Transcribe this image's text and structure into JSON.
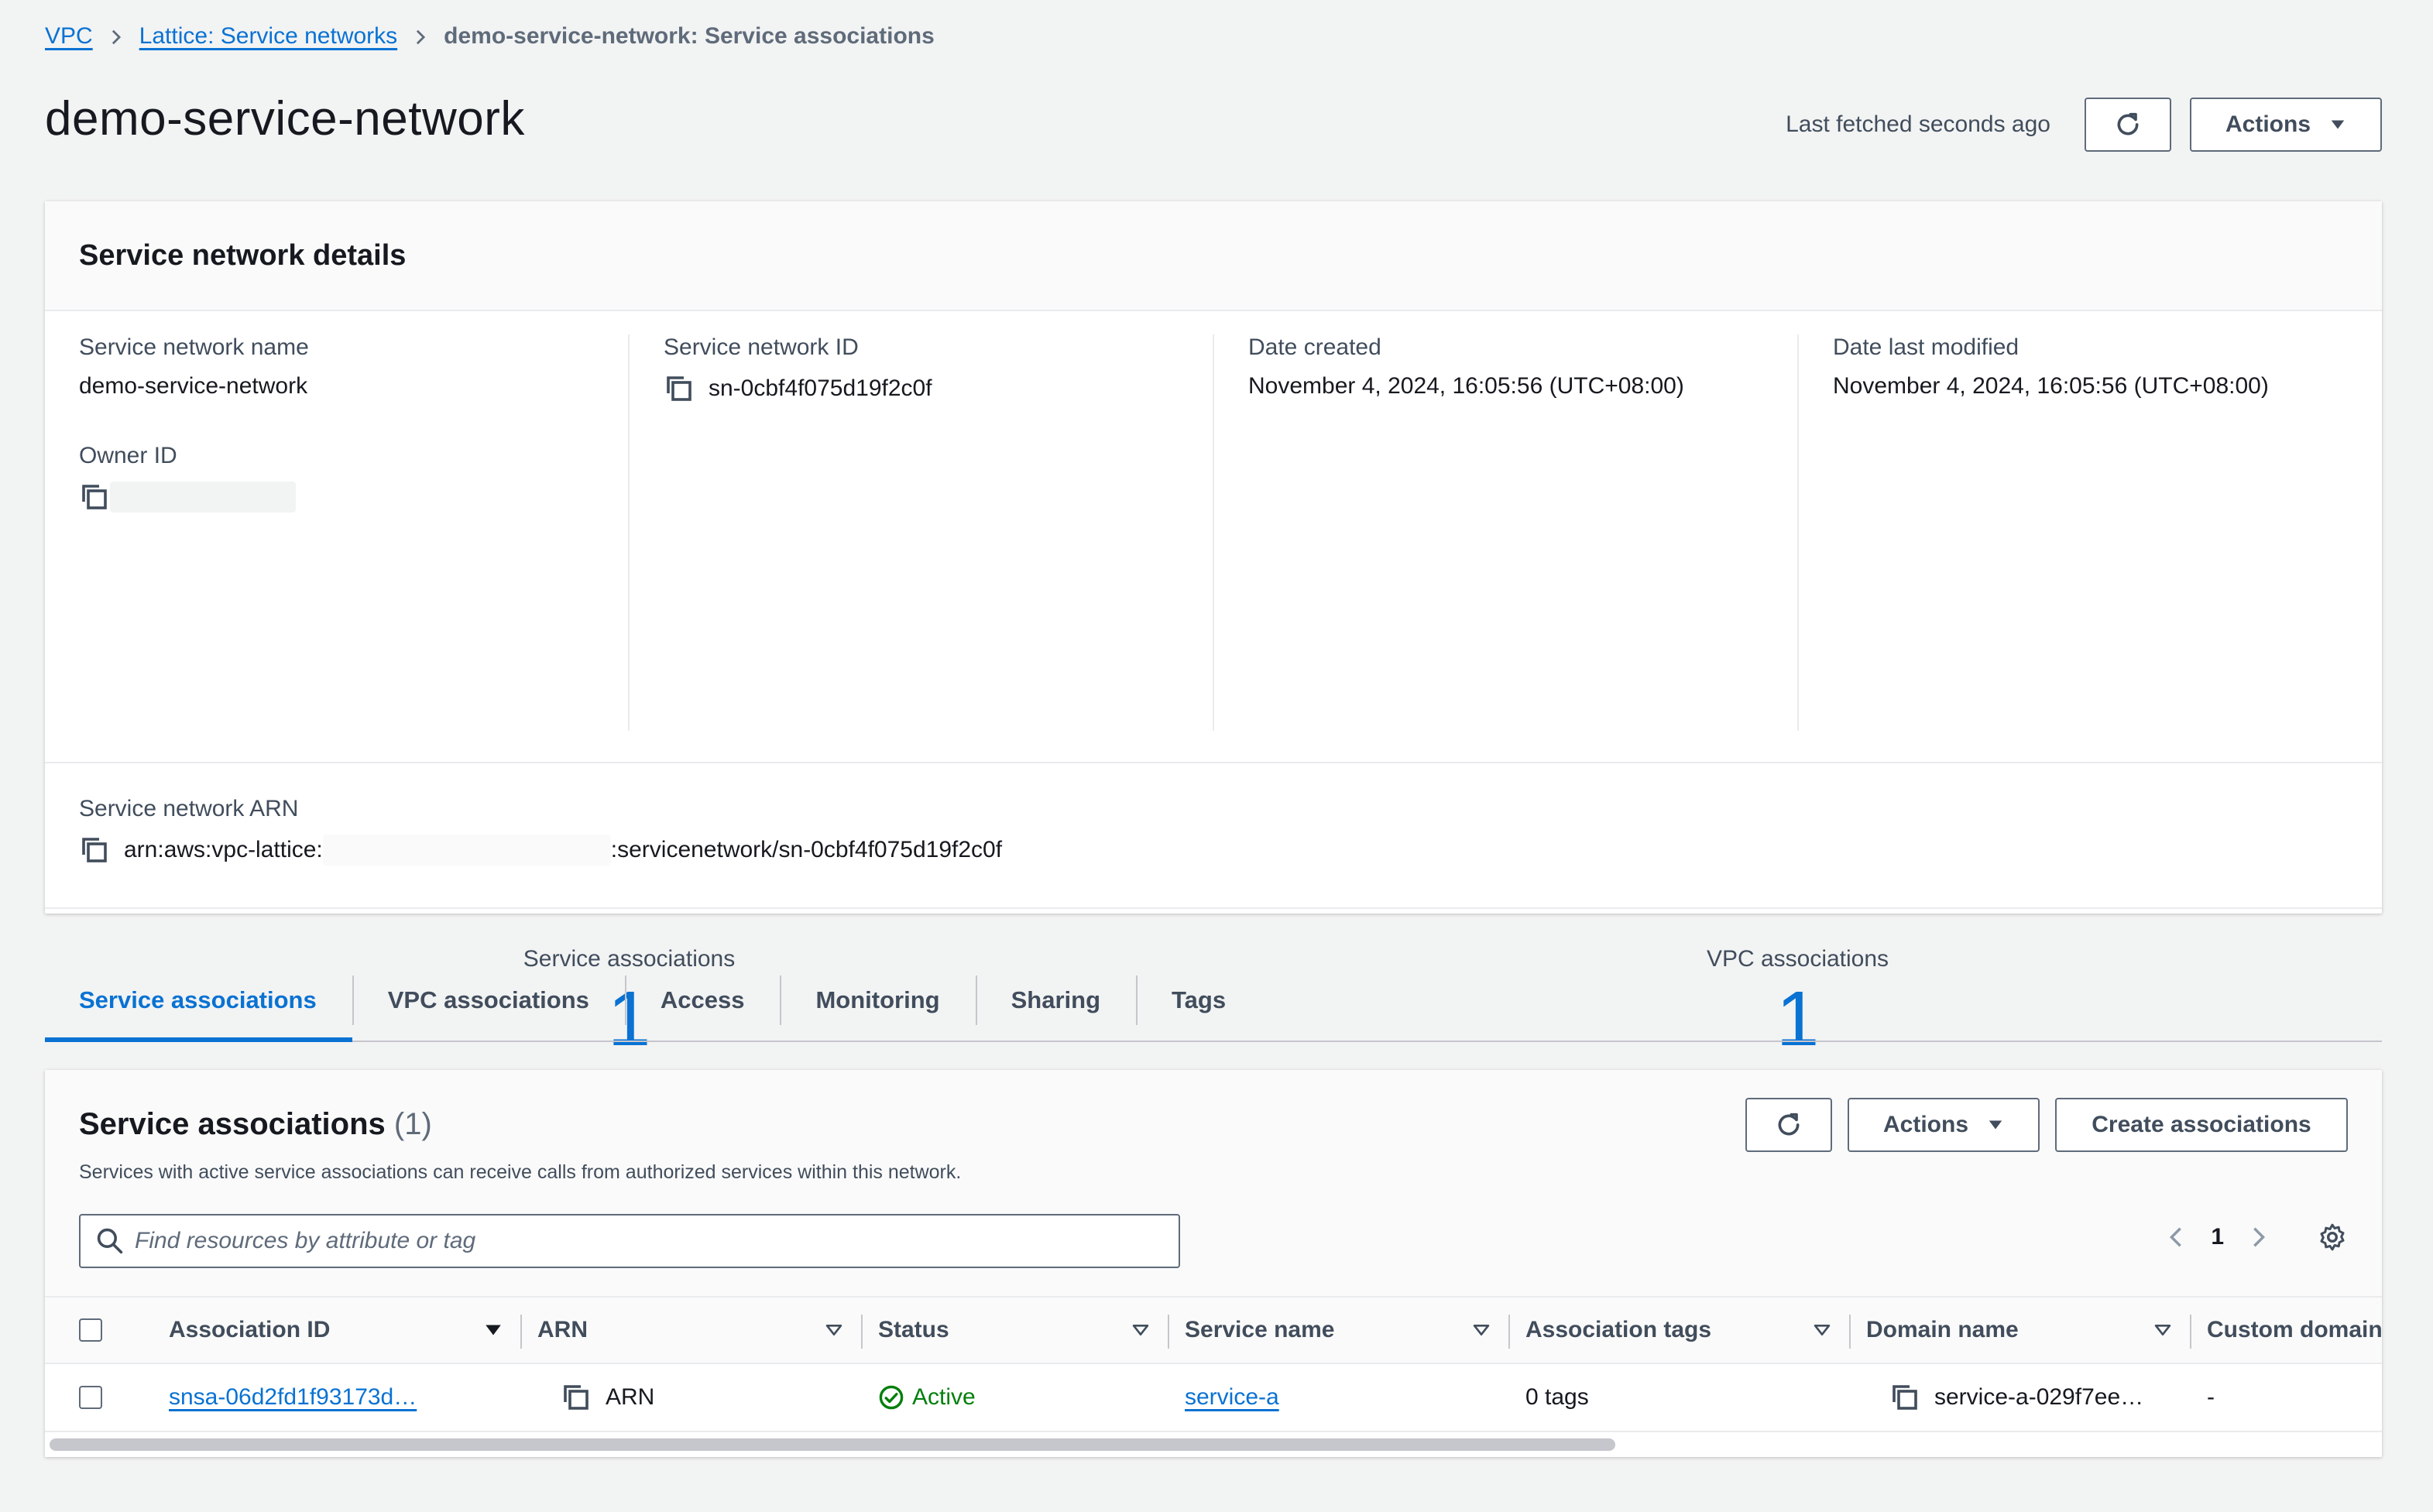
{
  "breadcrumb": {
    "items": [
      {
        "label": "VPC"
      },
      {
        "label": "Lattice: Service networks"
      }
    ],
    "current": "demo-service-network: Service associations"
  },
  "header": {
    "title": "demo-service-network",
    "last_fetched": "Last fetched seconds ago",
    "actions_label": "Actions"
  },
  "details": {
    "title": "Service network details",
    "service_network_name_label": "Service network name",
    "service_network_name": "demo-service-network",
    "owner_id_label": "Owner ID",
    "service_network_id_label": "Service network ID",
    "service_network_id": "sn-0cbf4f075d19f2c0f",
    "date_created_label": "Date created",
    "date_created": "November 4, 2024, 16:05:56 (UTC+08:00)",
    "date_modified_label": "Date last modified",
    "date_modified": "November 4, 2024, 16:05:56 (UTC+08:00)",
    "arn_label": "Service network ARN",
    "arn_prefix": "arn:aws:vpc-lattice:",
    "arn_suffix": ":servicenetwork/sn-0cbf4f075d19f2c0f",
    "service_assoc_label": "Service associations",
    "service_assoc_count": "1",
    "vpc_assoc_label": "VPC associations",
    "vpc_assoc_count": "1"
  },
  "tabs": [
    {
      "label": "Service associations",
      "active": true
    },
    {
      "label": "VPC associations"
    },
    {
      "label": "Access"
    },
    {
      "label": "Monitoring"
    },
    {
      "label": "Sharing"
    },
    {
      "label": "Tags"
    }
  ],
  "associations": {
    "title": "Service associations",
    "count": "(1)",
    "description": "Services with active service associations can receive calls from authorized services within this network.",
    "actions_label": "Actions",
    "create_label": "Create associations",
    "search_placeholder": "Find resources by attribute or tag",
    "page": "1",
    "columns": [
      "Association ID",
      "ARN",
      "Status",
      "Service name",
      "Association tags",
      "Domain name",
      "Custom domain na"
    ],
    "rows": [
      {
        "association_id": "snsa-06d2fd1f93173d…",
        "arn": "ARN",
        "status": "Active",
        "service_name": "service-a",
        "tags": "0 tags",
        "domain_name": "service-a-029f7ee…",
        "custom_domain": "-"
      }
    ]
  },
  "colors": {
    "link": "#0972d3",
    "success": "#037f0c",
    "border": "#5f6b7a"
  }
}
